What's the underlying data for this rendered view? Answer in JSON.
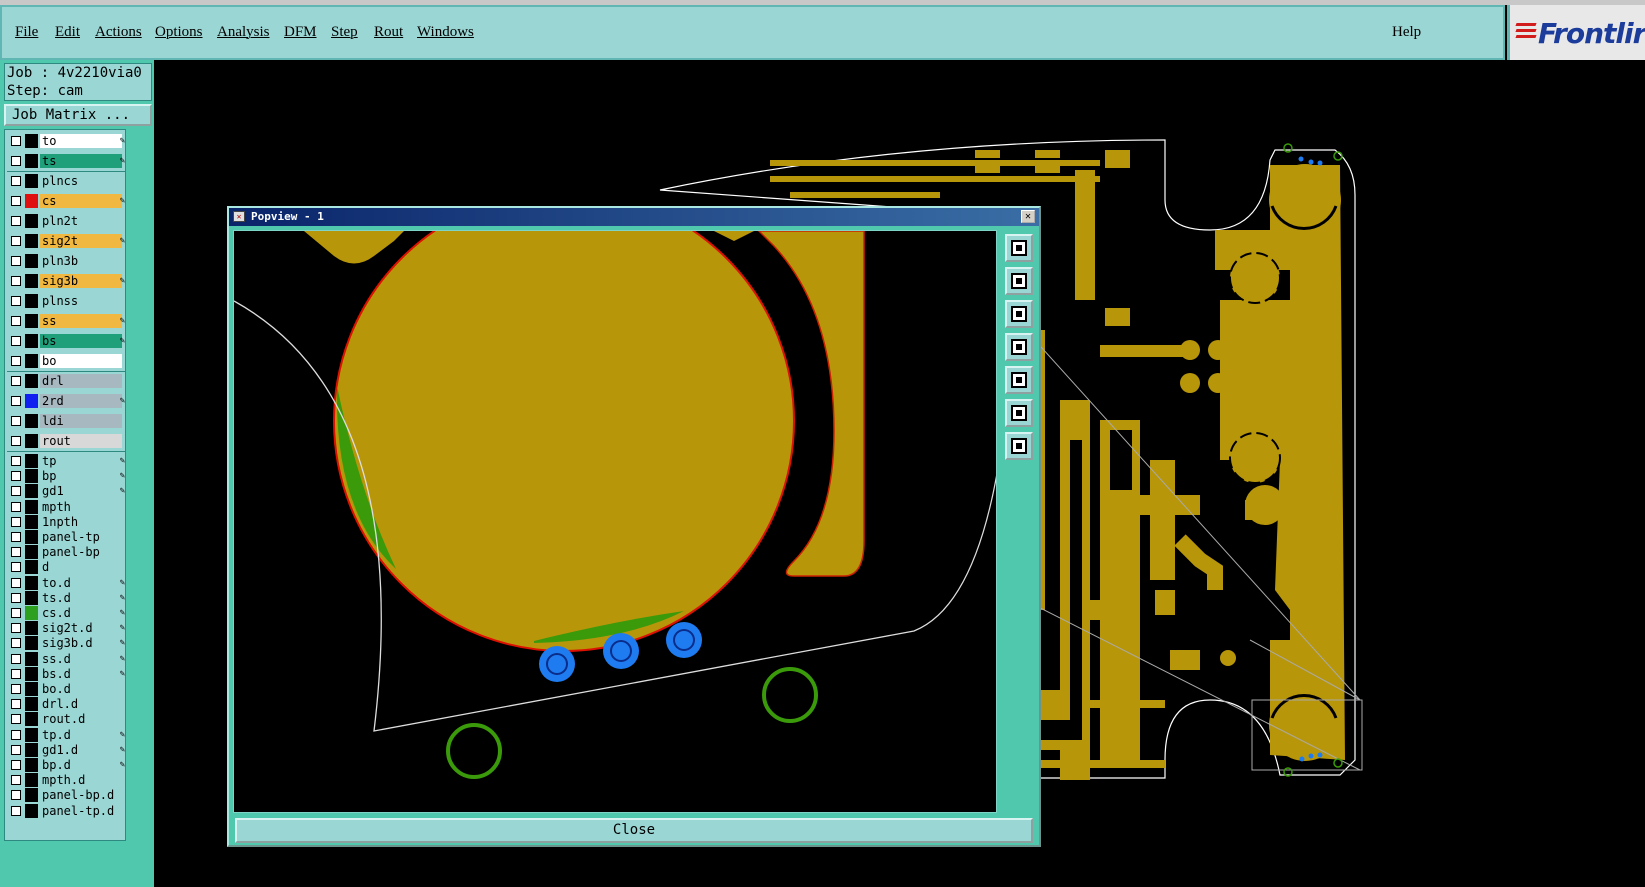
{
  "menubar": {
    "items": [
      "File",
      "Edit",
      "Actions",
      "Options",
      "Analysis",
      "DFM",
      "Step",
      "Rout",
      "Windows"
    ],
    "help": "Help"
  },
  "logo": {
    "text": "Frontlir"
  },
  "job": {
    "job_line": "Job : 4v2210via0",
    "step_line": "Step: cam"
  },
  "job_matrix_label": "Job Matrix ...",
  "layers": [
    {
      "name": "to",
      "bg": "#ffffff",
      "edit": true
    },
    {
      "name": "ts",
      "bg": "#1f9f7a",
      "edit": true
    },
    {
      "name": "plncs",
      "bg": "",
      "edit": false
    },
    {
      "name": "cs",
      "bg": "#f0b840",
      "swatch": "#e01010",
      "edit": true
    },
    {
      "name": "pln2t",
      "bg": "",
      "edit": false
    },
    {
      "name": "sig2t",
      "bg": "#f0b840",
      "edit": true
    },
    {
      "name": "pln3b",
      "bg": "",
      "edit": false
    },
    {
      "name": "sig3b",
      "bg": "#f0b840",
      "edit": true
    },
    {
      "name": "plnss",
      "bg": "",
      "edit": false
    },
    {
      "name": "ss",
      "bg": "#f0b840",
      "edit": true
    },
    {
      "name": "bs",
      "bg": "#1f9f7a",
      "edit": true
    },
    {
      "name": "bo",
      "bg": "#ffffff",
      "edit": false
    },
    {
      "name": "drl",
      "bg": "#a8b8c0",
      "edit": false
    },
    {
      "name": "2rd",
      "bg": "#a8b8c0",
      "swatch": "#1020f0",
      "edit": true
    },
    {
      "name": "ldi",
      "bg": "#a8b8c0",
      "edit": false
    },
    {
      "name": "rout",
      "bg": "#d8d8d8",
      "edit": false
    },
    {
      "name": "tp",
      "bg": "",
      "edit": true
    },
    {
      "name": "bp",
      "bg": "",
      "edit": true
    },
    {
      "name": "gd1",
      "bg": "",
      "edit": true
    },
    {
      "name": "mpth",
      "bg": "",
      "edit": false
    },
    {
      "name": "1npth",
      "bg": "",
      "edit": false
    },
    {
      "name": "panel-tp",
      "bg": "",
      "edit": false
    },
    {
      "name": "panel-bp",
      "bg": "",
      "edit": false
    },
    {
      "name": "d",
      "bg": "",
      "edit": false
    },
    {
      "name": "to.d",
      "bg": "",
      "edit": true
    },
    {
      "name": "ts.d",
      "bg": "",
      "edit": true
    },
    {
      "name": "cs.d",
      "bg": "",
      "swatch": "#2ea020",
      "edit": true
    },
    {
      "name": "sig2t.d",
      "bg": "",
      "edit": true
    },
    {
      "name": "sig3b.d",
      "bg": "",
      "edit": true
    },
    {
      "name": "ss.d",
      "bg": "",
      "edit": true
    },
    {
      "name": "bs.d",
      "bg": "",
      "edit": true
    },
    {
      "name": "bo.d",
      "bg": "",
      "edit": false
    },
    {
      "name": "drl.d",
      "bg": "",
      "edit": false
    },
    {
      "name": "rout.d",
      "bg": "",
      "edit": false
    },
    {
      "name": "tp.d",
      "bg": "",
      "edit": true
    },
    {
      "name": "gd1.d",
      "bg": "",
      "edit": true
    },
    {
      "name": "bp.d",
      "bg": "",
      "edit": true
    },
    {
      "name": "mpth.d",
      "bg": "",
      "edit": false
    },
    {
      "name": "panel-bp.d",
      "bg": "",
      "edit": false
    },
    {
      "name": "panel-tp.d",
      "bg": "",
      "edit": false
    }
  ],
  "popup": {
    "title": "Popview - 1",
    "close_label": "Close",
    "tool_icons": [
      "zoom-home-icon",
      "pan-up-icon",
      "pan-down-icon",
      "pan-left-icon",
      "pan-right-icon",
      "zoom-in-icon",
      "zoom-out-icon"
    ]
  },
  "colors": {
    "copper": "#b8960a",
    "green": "#3a9a0a",
    "via_blue": "#1e7cf0",
    "profile": "#ffffff",
    "panel_bg": "#4fc8ae",
    "menu_bg": "#9ad6d4"
  }
}
